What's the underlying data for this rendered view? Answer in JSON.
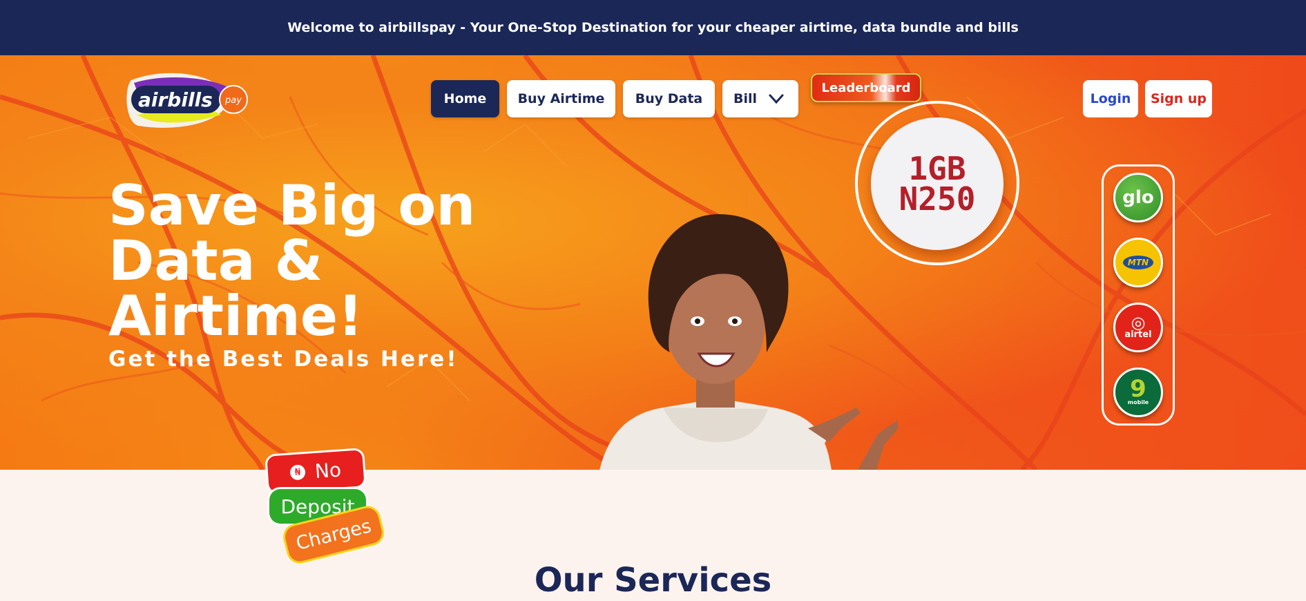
{
  "announcement": "Welcome to airbillspay - Your One-Stop Destination for your cheaper airtime, data bundle and bills",
  "logo": {
    "brand": "airbills",
    "badge": "pay"
  },
  "nav": {
    "home": "Home",
    "buy_airtime": "Buy Airtime",
    "buy_data": "Buy Data",
    "bill": "Bill",
    "leaderboard": "Leaderboard"
  },
  "auth": {
    "login": "Login",
    "signup": "Sign up"
  },
  "promo": {
    "line1": "1GB",
    "line2": "N250"
  },
  "hero": {
    "headline_1": "Save Big on",
    "headline_2": "Data &",
    "headline_3": "Airtime!",
    "subline": "Get the Best Deals Here!"
  },
  "networks": {
    "glo": "glo",
    "mtn": "MTN",
    "airtel": "airtel",
    "ninemobile_num": "9",
    "ninemobile_label": "mobile"
  },
  "stickers": {
    "no": "No",
    "naira": "₦",
    "deposit": "Deposit",
    "charges": "Charges"
  },
  "services": {
    "title": "Our Services"
  },
  "colors": {
    "navy": "#1b2757",
    "orange": "#f26a17",
    "red": "#d9261c",
    "green": "#2eaa2a"
  }
}
